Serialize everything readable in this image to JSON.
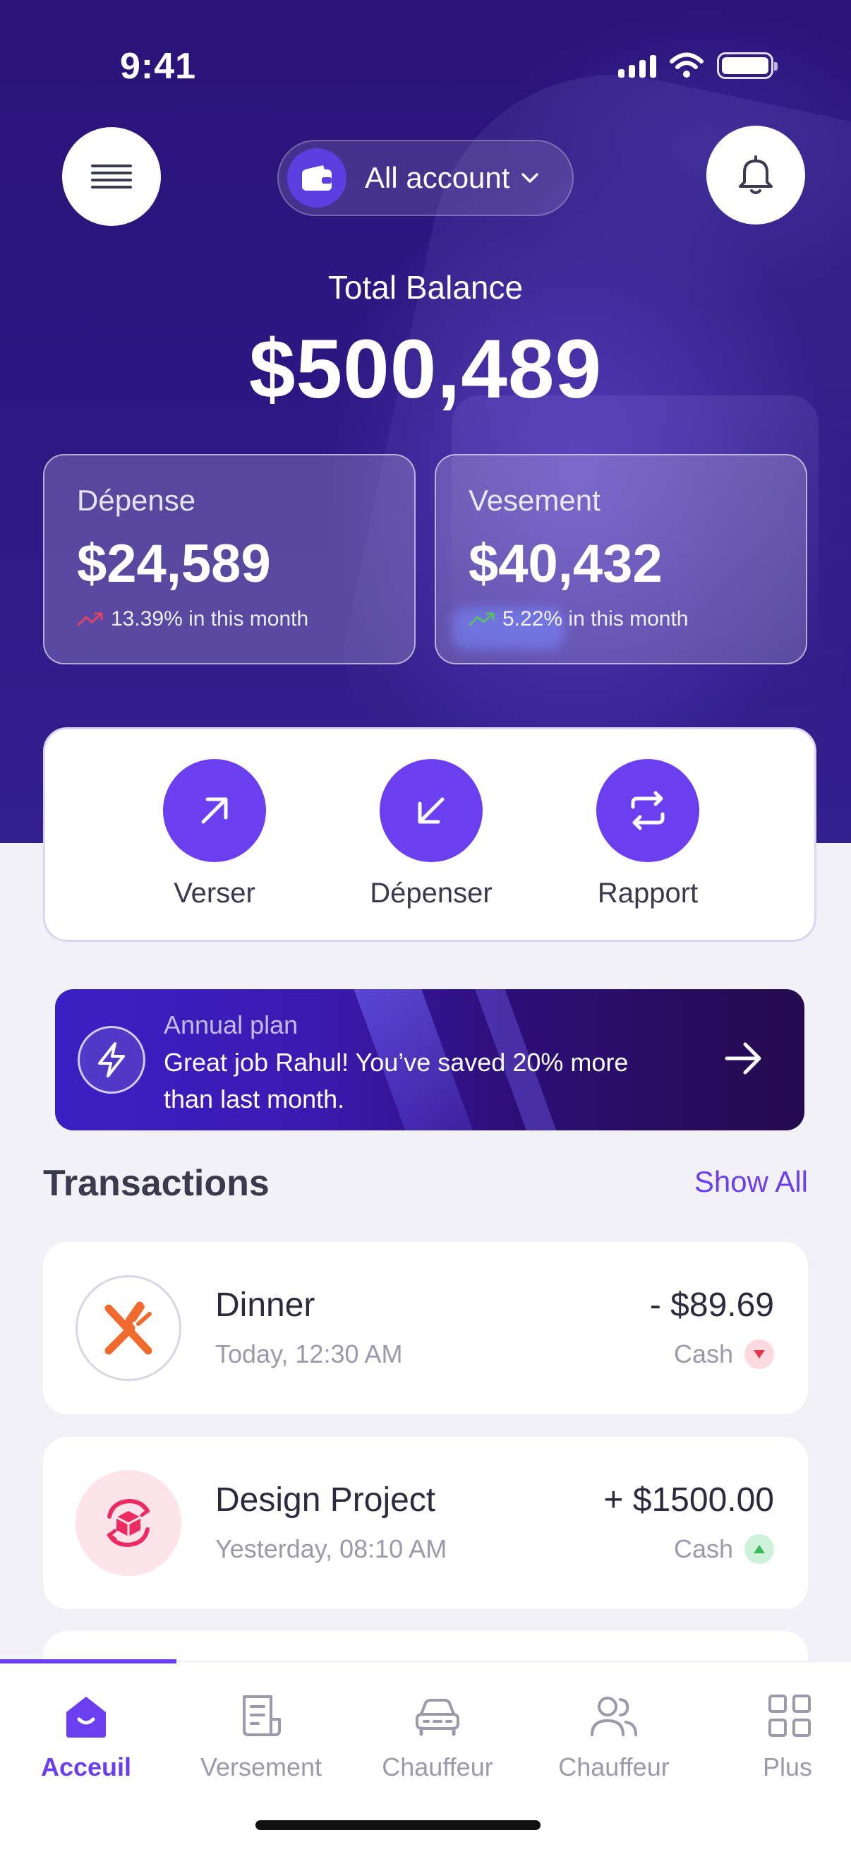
{
  "status_bar": {
    "time": "9:41"
  },
  "header": {
    "account_selector": "All account"
  },
  "balance": {
    "label": "Total Balance",
    "value": "$500,489"
  },
  "stats": [
    {
      "title": "Dépense",
      "amount": "$24,589",
      "trend": "13.39% in this month",
      "direction": "up",
      "trend_color": "#F0445E"
    },
    {
      "title": "Vesement",
      "amount": "$40,432",
      "trend": "5.22% in this month",
      "direction": "up",
      "trend_color": "#58C95B"
    }
  ],
  "actions": [
    {
      "label": "Verser",
      "icon": "arrow-up-right-icon"
    },
    {
      "label": "Dépenser",
      "icon": "arrow-down-left-icon"
    },
    {
      "label": "Rapport",
      "icon": "swap-arrows-icon"
    }
  ],
  "promo": {
    "title": "Annual plan",
    "text": "Great job Rahul! You’ve saved 20% more than last month.",
    "icon": "lightning-icon"
  },
  "transactions": {
    "heading": "Transactions",
    "show_all": "Show All",
    "items": [
      {
        "title": "Dinner",
        "time": "Today, 12:30 AM",
        "amount": "- $89.69",
        "method": "Cash",
        "direction": "down",
        "icon": "fork-knife-icon"
      },
      {
        "title": "Design Project",
        "time": "Yesterday, 08:10 AM",
        "amount": "+ $1500.00",
        "method": "Cash",
        "direction": "up",
        "icon": "box-refresh-icon"
      }
    ]
  },
  "bottom_nav": {
    "items": [
      {
        "label": "Acceuil",
        "icon": "home-icon",
        "active": true
      },
      {
        "label": "Versement",
        "icon": "document-icon",
        "active": false
      },
      {
        "label": "Chauffeur",
        "icon": "car-icon",
        "active": false
      },
      {
        "label": "Chauffeur",
        "icon": "users-icon",
        "active": false
      },
      {
        "label": "Plus",
        "icon": "grid-icon",
        "active": false
      }
    ]
  },
  "colors": {
    "accent": "#6B3FF0",
    "hero_bg": "#2C1782",
    "page_bg": "#F1F1F7"
  }
}
